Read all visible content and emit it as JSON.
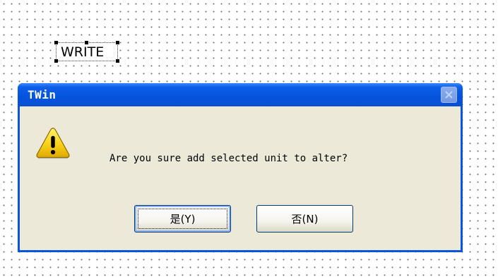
{
  "canvas": {
    "object_label": "WRITE"
  },
  "dialog": {
    "title": "TWin",
    "message": "Are you sure add selected unit to alter?",
    "icon": "warning-icon",
    "buttons": {
      "yes_label": "是(Y)",
      "no_label": "否(N)"
    }
  },
  "colors": {
    "titlebar": "#0453de",
    "client_bg": "#ece9d8",
    "warning_yellow": "#f8d21a"
  }
}
